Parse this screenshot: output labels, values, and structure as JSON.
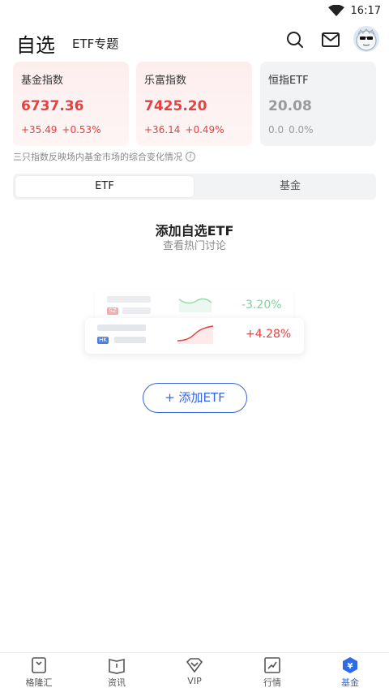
{
  "status": {
    "time": "16:17"
  },
  "header": {
    "title": "自选",
    "subtitle": "ETF专题"
  },
  "indices": [
    {
      "name": "基金指数",
      "value": "6737.36",
      "change": "+35.49",
      "pct": "+0.53%",
      "state": "up"
    },
    {
      "name": "乐富指数",
      "value": "7425.20",
      "change": "+36.14",
      "pct": "+0.49%",
      "state": "up"
    },
    {
      "name": "恒指ETF",
      "value": "20.08",
      "change": "0.0",
      "pct": "0.0%",
      "state": "flat"
    }
  ],
  "note": "三只指数反映场内基金市场的综合变化情况",
  "tabs": {
    "active": "ETF",
    "inactive": "基金"
  },
  "empty": {
    "title": "添加自选ETF",
    "subtitle": "查看热门讨论"
  },
  "illustration": {
    "back": {
      "tag": "SZ",
      "pct": "-3.20%"
    },
    "front": {
      "tag": "HK",
      "pct": "+4.28%"
    }
  },
  "add_button": "+ 添加ETF",
  "nav": [
    {
      "label": "格隆汇",
      "icon": "gelonghui-icon"
    },
    {
      "label": "资讯",
      "icon": "news-book-icon"
    },
    {
      "label": "VIP",
      "icon": "vip-diamond-icon"
    },
    {
      "label": "行情",
      "icon": "market-chart-icon"
    },
    {
      "label": "基金",
      "icon": "fund-yen-icon"
    }
  ],
  "colors": {
    "up": "#e8403f",
    "down": "#5cc07a",
    "accent": "#2f6be6",
    "flat": "#9a9a9a"
  }
}
